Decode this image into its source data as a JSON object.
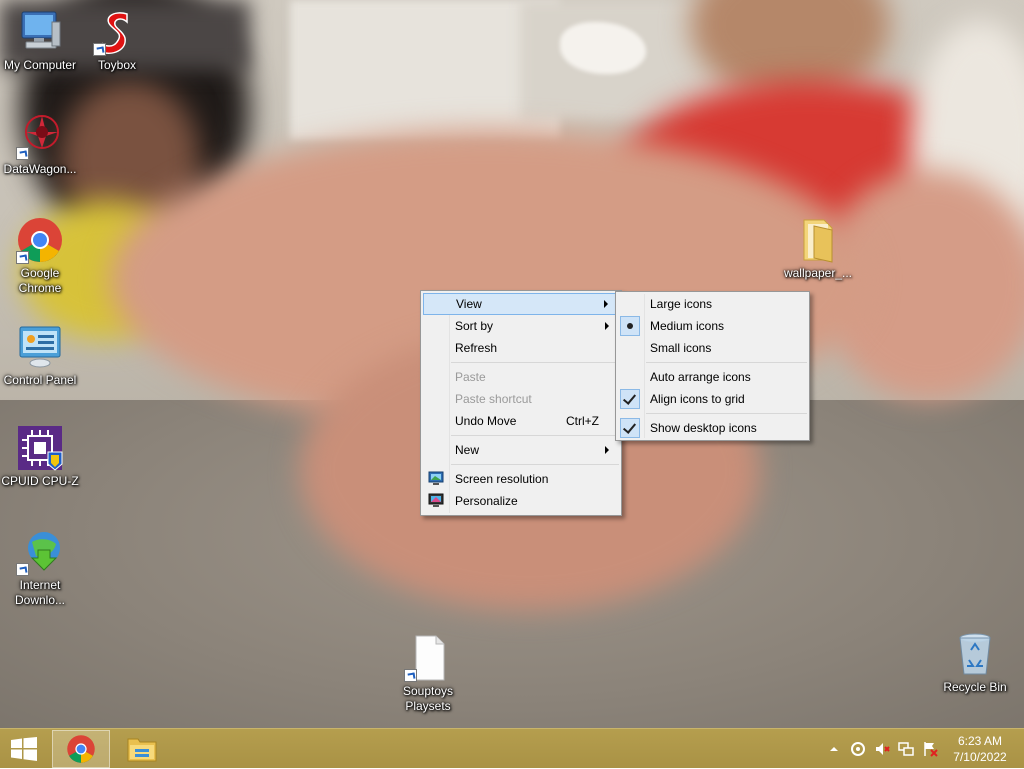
{
  "desktop": {
    "icons": [
      {
        "label": "My Computer"
      },
      {
        "label": "Toybox"
      },
      {
        "label": "DataWagon..."
      },
      {
        "label": "Google Chrome"
      },
      {
        "label": "Control Panel"
      },
      {
        "label": "CPUID CPU-Z"
      },
      {
        "label": "Internet Downlo..."
      },
      {
        "label": "wallpaper_..."
      },
      {
        "label": "Souptoys Playsets"
      },
      {
        "label": "Recycle Bin"
      }
    ]
  },
  "context_menu": {
    "items": [
      {
        "label": "View",
        "submenu": true,
        "highlighted": true
      },
      {
        "label": "Sort by",
        "submenu": true
      },
      {
        "label": "Refresh"
      },
      {
        "label": "Paste",
        "disabled": true
      },
      {
        "label": "Paste shortcut",
        "disabled": true
      },
      {
        "label": "Undo Move",
        "shortcut": "Ctrl+Z"
      },
      {
        "label": "New",
        "submenu": true
      },
      {
        "label": "Screen resolution",
        "icon": "screen-resolution-icon"
      },
      {
        "label": "Personalize",
        "icon": "personalize-icon"
      }
    ]
  },
  "view_submenu": {
    "items": [
      {
        "label": "Large icons"
      },
      {
        "label": "Medium icons",
        "selected": true
      },
      {
        "label": "Small icons"
      },
      {
        "label": "Auto arrange icons"
      },
      {
        "label": "Align icons to grid",
        "checked": true
      },
      {
        "label": "Show desktop icons",
        "checked": true
      }
    ]
  },
  "taskbar": {
    "start_icon": "windows-logo-icon",
    "pinned": [
      {
        "name": "chrome",
        "icon": "chrome-icon",
        "active": true
      },
      {
        "name": "file-explorer",
        "icon": "folder-icon"
      }
    ],
    "tray_icons": [
      "show-hidden-icons-chevron",
      "network-monitor-icon",
      "volume-muted-icon",
      "network-icon",
      "action-center-flag-icon"
    ],
    "clock": {
      "time": "6:23 AM",
      "date": "7/10/2022"
    }
  },
  "colors": {
    "taskbar": "#ad964a",
    "menu_bg": "#f0f0f0",
    "menu_highlight": "#d5e7f8"
  }
}
